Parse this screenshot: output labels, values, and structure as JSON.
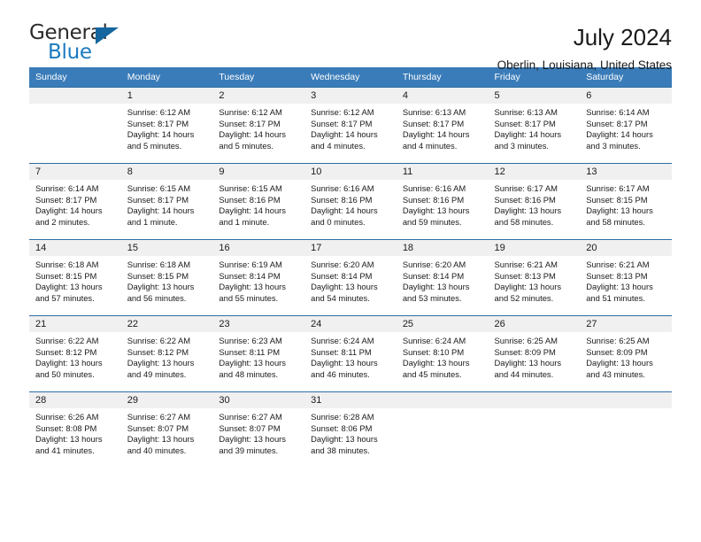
{
  "brand": {
    "name_part1": "General",
    "name_part2": "Blue",
    "triangle_icon": "triangle-icon",
    "accent_color": "#1c7ac0"
  },
  "header": {
    "title": "July 2024",
    "location": "Oberlin, Louisiana, United States"
  },
  "calendar": {
    "header_bg": "#3a7cb9",
    "row_border_color": "#2e6da4",
    "daynum_bg": "#f0f0f0",
    "weekday_headers": [
      "Sunday",
      "Monday",
      "Tuesday",
      "Wednesday",
      "Thursday",
      "Friday",
      "Saturday"
    ],
    "weeks": [
      [
        {
          "day": "",
          "lines": []
        },
        {
          "day": "1",
          "lines": [
            "Sunrise: 6:12 AM",
            "Sunset: 8:17 PM",
            "Daylight: 14 hours",
            "and 5 minutes."
          ]
        },
        {
          "day": "2",
          "lines": [
            "Sunrise: 6:12 AM",
            "Sunset: 8:17 PM",
            "Daylight: 14 hours",
            "and 5 minutes."
          ]
        },
        {
          "day": "3",
          "lines": [
            "Sunrise: 6:12 AM",
            "Sunset: 8:17 PM",
            "Daylight: 14 hours",
            "and 4 minutes."
          ]
        },
        {
          "day": "4",
          "lines": [
            "Sunrise: 6:13 AM",
            "Sunset: 8:17 PM",
            "Daylight: 14 hours",
            "and 4 minutes."
          ]
        },
        {
          "day": "5",
          "lines": [
            "Sunrise: 6:13 AM",
            "Sunset: 8:17 PM",
            "Daylight: 14 hours",
            "and 3 minutes."
          ]
        },
        {
          "day": "6",
          "lines": [
            "Sunrise: 6:14 AM",
            "Sunset: 8:17 PM",
            "Daylight: 14 hours",
            "and 3 minutes."
          ]
        }
      ],
      [
        {
          "day": "7",
          "lines": [
            "Sunrise: 6:14 AM",
            "Sunset: 8:17 PM",
            "Daylight: 14 hours",
            "and 2 minutes."
          ]
        },
        {
          "day": "8",
          "lines": [
            "Sunrise: 6:15 AM",
            "Sunset: 8:17 PM",
            "Daylight: 14 hours",
            "and 1 minute."
          ]
        },
        {
          "day": "9",
          "lines": [
            "Sunrise: 6:15 AM",
            "Sunset: 8:16 PM",
            "Daylight: 14 hours",
            "and 1 minute."
          ]
        },
        {
          "day": "10",
          "lines": [
            "Sunrise: 6:16 AM",
            "Sunset: 8:16 PM",
            "Daylight: 14 hours",
            "and 0 minutes."
          ]
        },
        {
          "day": "11",
          "lines": [
            "Sunrise: 6:16 AM",
            "Sunset: 8:16 PM",
            "Daylight: 13 hours",
            "and 59 minutes."
          ]
        },
        {
          "day": "12",
          "lines": [
            "Sunrise: 6:17 AM",
            "Sunset: 8:16 PM",
            "Daylight: 13 hours",
            "and 58 minutes."
          ]
        },
        {
          "day": "13",
          "lines": [
            "Sunrise: 6:17 AM",
            "Sunset: 8:15 PM",
            "Daylight: 13 hours",
            "and 58 minutes."
          ]
        }
      ],
      [
        {
          "day": "14",
          "lines": [
            "Sunrise: 6:18 AM",
            "Sunset: 8:15 PM",
            "Daylight: 13 hours",
            "and 57 minutes."
          ]
        },
        {
          "day": "15",
          "lines": [
            "Sunrise: 6:18 AM",
            "Sunset: 8:15 PM",
            "Daylight: 13 hours",
            "and 56 minutes."
          ]
        },
        {
          "day": "16",
          "lines": [
            "Sunrise: 6:19 AM",
            "Sunset: 8:14 PM",
            "Daylight: 13 hours",
            "and 55 minutes."
          ]
        },
        {
          "day": "17",
          "lines": [
            "Sunrise: 6:20 AM",
            "Sunset: 8:14 PM",
            "Daylight: 13 hours",
            "and 54 minutes."
          ]
        },
        {
          "day": "18",
          "lines": [
            "Sunrise: 6:20 AM",
            "Sunset: 8:14 PM",
            "Daylight: 13 hours",
            "and 53 minutes."
          ]
        },
        {
          "day": "19",
          "lines": [
            "Sunrise: 6:21 AM",
            "Sunset: 8:13 PM",
            "Daylight: 13 hours",
            "and 52 minutes."
          ]
        },
        {
          "day": "20",
          "lines": [
            "Sunrise: 6:21 AM",
            "Sunset: 8:13 PM",
            "Daylight: 13 hours",
            "and 51 minutes."
          ]
        }
      ],
      [
        {
          "day": "21",
          "lines": [
            "Sunrise: 6:22 AM",
            "Sunset: 8:12 PM",
            "Daylight: 13 hours",
            "and 50 minutes."
          ]
        },
        {
          "day": "22",
          "lines": [
            "Sunrise: 6:22 AM",
            "Sunset: 8:12 PM",
            "Daylight: 13 hours",
            "and 49 minutes."
          ]
        },
        {
          "day": "23",
          "lines": [
            "Sunrise: 6:23 AM",
            "Sunset: 8:11 PM",
            "Daylight: 13 hours",
            "and 48 minutes."
          ]
        },
        {
          "day": "24",
          "lines": [
            "Sunrise: 6:24 AM",
            "Sunset: 8:11 PM",
            "Daylight: 13 hours",
            "and 46 minutes."
          ]
        },
        {
          "day": "25",
          "lines": [
            "Sunrise: 6:24 AM",
            "Sunset: 8:10 PM",
            "Daylight: 13 hours",
            "and 45 minutes."
          ]
        },
        {
          "day": "26",
          "lines": [
            "Sunrise: 6:25 AM",
            "Sunset: 8:09 PM",
            "Daylight: 13 hours",
            "and 44 minutes."
          ]
        },
        {
          "day": "27",
          "lines": [
            "Sunrise: 6:25 AM",
            "Sunset: 8:09 PM",
            "Daylight: 13 hours",
            "and 43 minutes."
          ]
        }
      ],
      [
        {
          "day": "28",
          "lines": [
            "Sunrise: 6:26 AM",
            "Sunset: 8:08 PM",
            "Daylight: 13 hours",
            "and 41 minutes."
          ]
        },
        {
          "day": "29",
          "lines": [
            "Sunrise: 6:27 AM",
            "Sunset: 8:07 PM",
            "Daylight: 13 hours",
            "and 40 minutes."
          ]
        },
        {
          "day": "30",
          "lines": [
            "Sunrise: 6:27 AM",
            "Sunset: 8:07 PM",
            "Daylight: 13 hours",
            "and 39 minutes."
          ]
        },
        {
          "day": "31",
          "lines": [
            "Sunrise: 6:28 AM",
            "Sunset: 8:06 PM",
            "Daylight: 13 hours",
            "and 38 minutes."
          ]
        },
        {
          "day": "",
          "lines": []
        },
        {
          "day": "",
          "lines": []
        },
        {
          "day": "",
          "lines": []
        }
      ]
    ]
  }
}
